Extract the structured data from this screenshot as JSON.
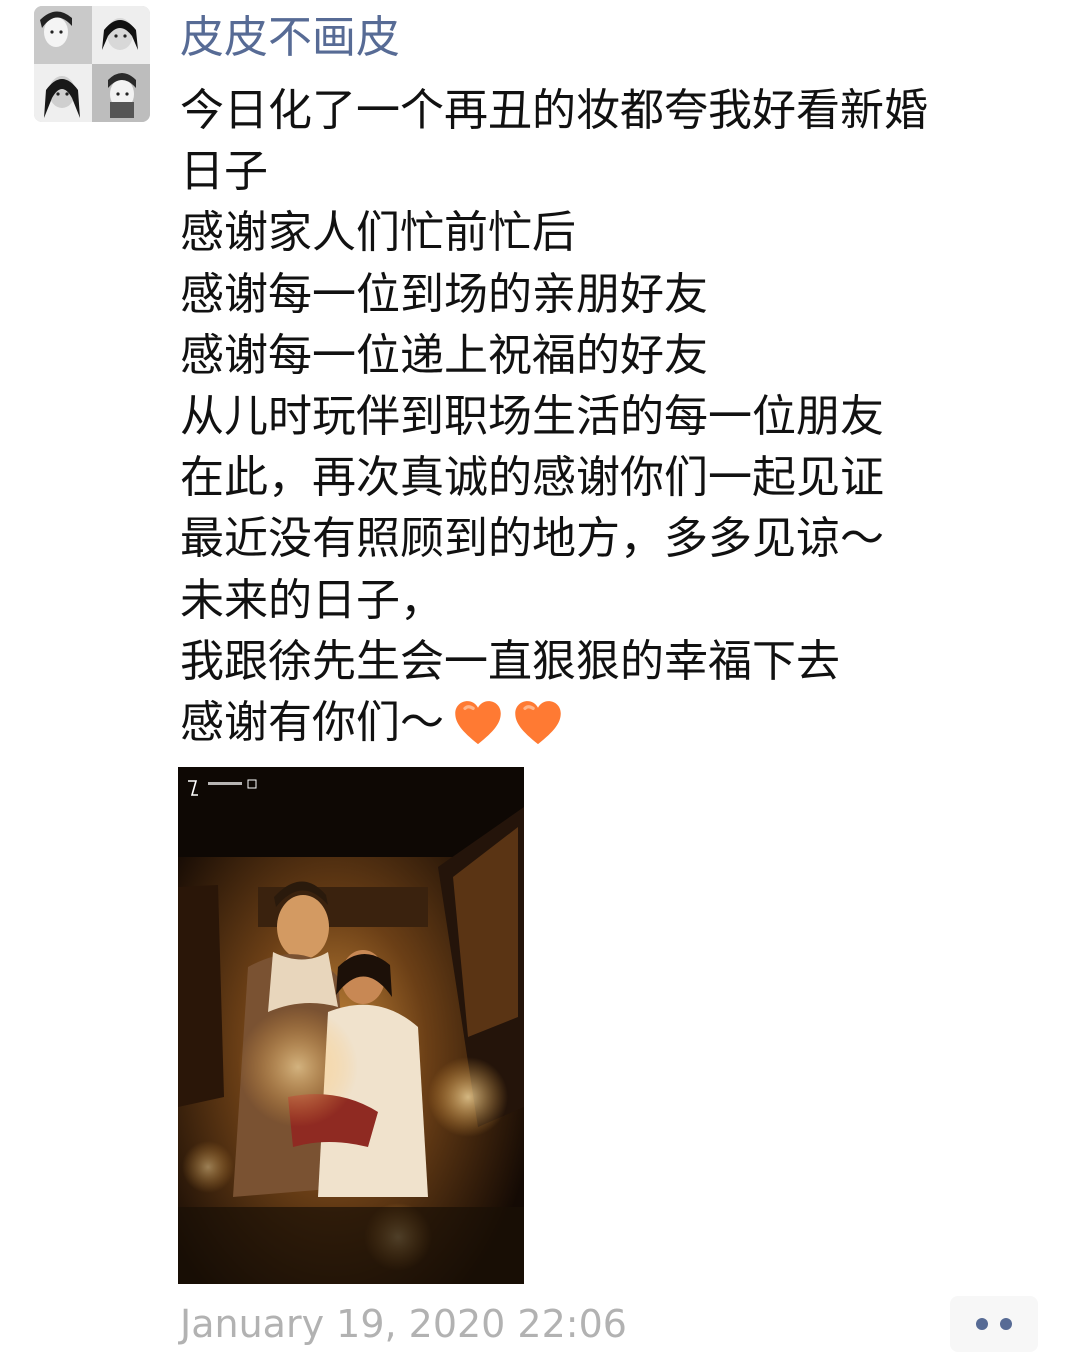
{
  "post": {
    "author": "皮皮不画皮",
    "lines": [
      "今日化了一个再丑的妆都夸我好看新婚",
      "日子",
      "感谢家人们忙前忙后",
      "感谢每一位到场的亲朋好友",
      "感谢每一位递上祝福的好友",
      "从儿时玩伴到职场生活的每一位朋友",
      "在此，再次真诚的感谢你们一起见证",
      "最近没有照顾到的地方，多多见谅～",
      "未来的日子，",
      "我跟徐先生会一直狠狠的幸福下去",
      "感谢有你们～"
    ],
    "emoji": [
      "orange-heart",
      "orange-heart"
    ],
    "timestamp": "January 19, 2020 22:06"
  },
  "colors": {
    "author": "#576b95",
    "text": "#111111",
    "timestamp": "#b2b2b2",
    "heart": "#ff7a33",
    "more_dots": "#576b95"
  }
}
